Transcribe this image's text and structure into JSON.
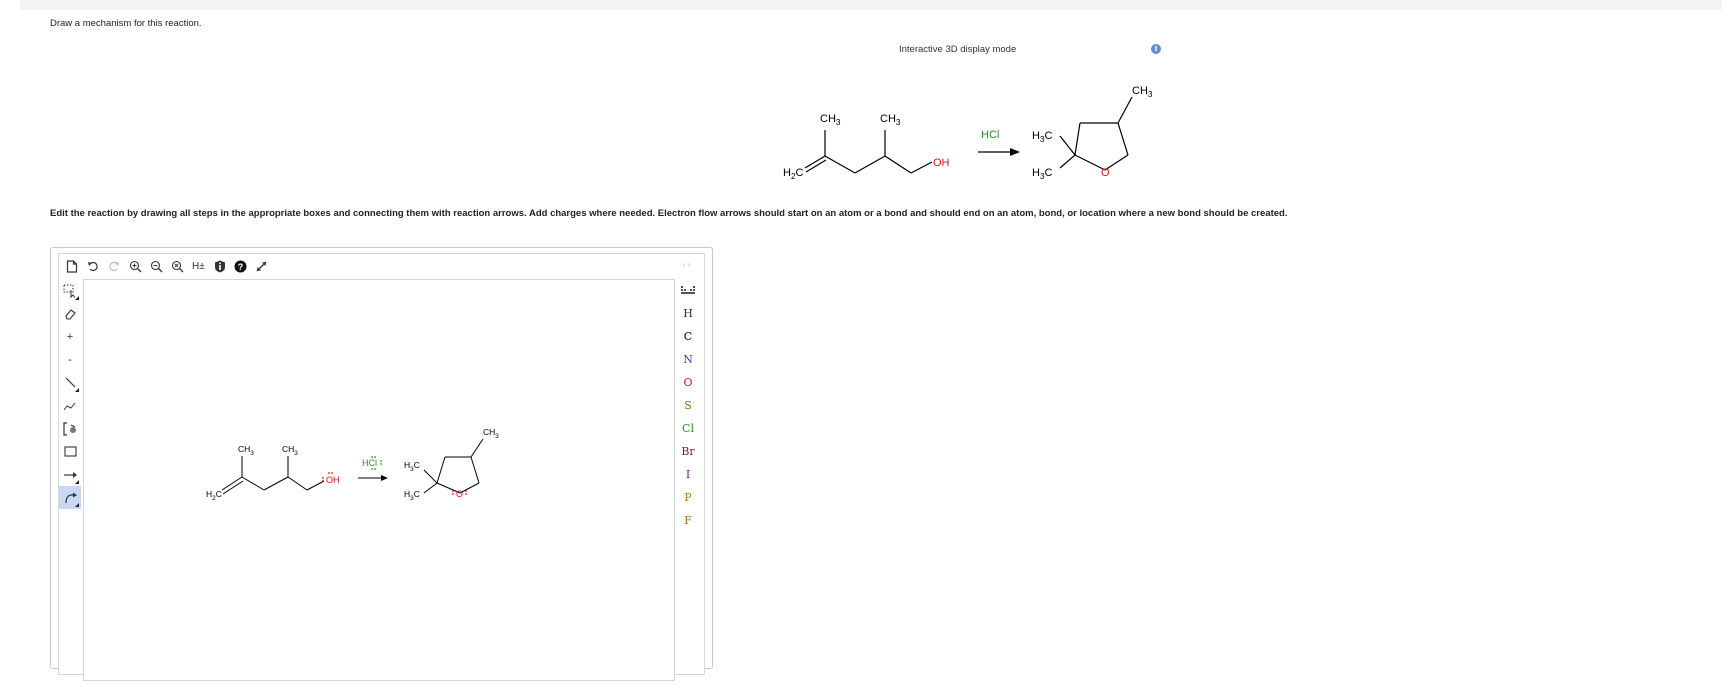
{
  "question": {
    "prompt": "Draw a mechanism for this reaction."
  },
  "display": {
    "mode_label": "Interactive 3D display mode",
    "info_icon": "i"
  },
  "reaction": {
    "reactant": {
      "ch3_a": "CH3",
      "ch3_b": "CH3",
      "h2c": "H2C",
      "oh": "OH"
    },
    "reagent": "HCl",
    "product": {
      "ch3": "CH3",
      "h3c_top": "H3C",
      "h3c_bottom": "H3C",
      "o": "O"
    }
  },
  "instructions": "Edit the reaction by drawing all steps in the appropriate boxes and connecting them with reaction arrows. Add charges where needed. Electron flow arrows should start on an atom or a bond and should end on an atom, bond, or location where a new bond should be created.",
  "editor": {
    "top_toolbar": {
      "new": "new-document-icon",
      "undo": "undo-icon",
      "redo": "redo-icon",
      "zoom_in": "zoom-in-icon",
      "zoom_out": "zoom-out-icon",
      "zoom_reset": "zoom-reset-icon",
      "h_toggle_label": "H±",
      "info": "info-icon",
      "help": "help-icon",
      "fullscreen": "fullscreen-icon",
      "nav_arrows": "‹ ›"
    },
    "left_toolbar": {
      "plus": "+",
      "minus": "-"
    },
    "elements": [
      "H",
      "C",
      "N",
      "O",
      "S",
      "Cl",
      "Br",
      "I",
      "P",
      "F"
    ],
    "element_colors": {
      "H": "#333333",
      "C": "#000000",
      "N": "#2b3fb5",
      "O": "#e01010",
      "S": "#8a6d00",
      "Cl": "#1e9a1e",
      "Br": "#7a1f1f",
      "I": "#6a1b9a",
      "P": "#c77800",
      "F": "#b36b00"
    },
    "canvas_reaction": {
      "reactant": {
        "ch3_a": "CH3",
        "ch3_b": "CH3",
        "h2c": "H2C",
        "oh": "OH"
      },
      "reagent": "HCl",
      "product": {
        "ch3": "CH3",
        "h3c_top": "H3C",
        "h3c_bottom": "H3C",
        "o": "O"
      }
    }
  },
  "colors": {
    "oxygen": "#e01010",
    "reagent_green": "#1e9a1e",
    "active_tool": "#c6d8f3",
    "info_blue": "#5b8fd0"
  }
}
